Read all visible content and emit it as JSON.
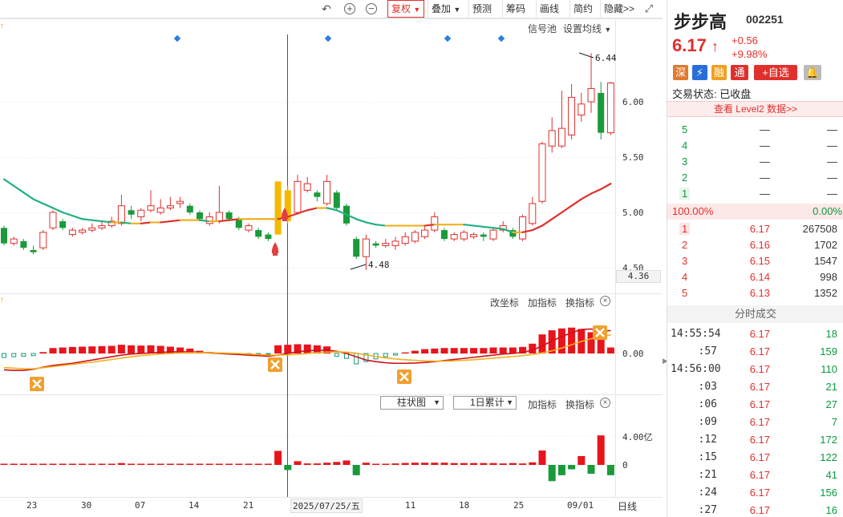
{
  "toolbar": {
    "fuquan": "复权",
    "diejia": "叠加",
    "yuce": "预测",
    "chouma": "筹码",
    "huaxian": "画线",
    "jianyue": "简约",
    "yincang": "隐藏>>"
  },
  "main_panel": {
    "signal_pool": "信号池",
    "ma_setting": "设置均线",
    "high_label": "6.44",
    "low_label": "4.48",
    "cursor_price": "4.36",
    "yticks": [
      "6.00",
      "5.50",
      "5.00",
      "4.50"
    ]
  },
  "macd_panel": {
    "gaizuobiao": "改坐标",
    "jiazhibiao": "加指标",
    "huanzhibiao": "换指标",
    "ytick": "0.00"
  },
  "vol_panel": {
    "chart_type": "柱状图",
    "accum": "1日累计",
    "jiazhibiao": "加指标",
    "huanzhibiao": "换指标",
    "yticks": [
      "4.00亿",
      "0"
    ]
  },
  "xaxis": {
    "ticks": [
      "23",
      "30",
      "07",
      "14",
      "21",
      "11",
      "18",
      "25",
      "09/01"
    ],
    "cursor_date": "2025/07/25/五",
    "period": "日线"
  },
  "stock": {
    "name": "步步高",
    "code": "002251",
    "price": "6.17",
    "change": "+0.56",
    "change_pct": "+9.98%",
    "tags": [
      "深",
      "融",
      "通"
    ],
    "add_fav": "+自选",
    "status_label": "交易状态:",
    "status": "已收盘",
    "level2": "查看 Level2 数据>>"
  },
  "sell_orders": [
    {
      "level": "5",
      "price": "—",
      "vol": "—"
    },
    {
      "level": "4",
      "price": "—",
      "vol": "—"
    },
    {
      "level": "3",
      "price": "—",
      "vol": "—"
    },
    {
      "level": "2",
      "price": "—",
      "vol": "—"
    },
    {
      "level": "1",
      "price": "—",
      "vol": "—"
    }
  ],
  "ratio": {
    "left": "100.00%",
    "right": "0.00%"
  },
  "buy_orders": [
    {
      "level": "1",
      "price": "6.17",
      "vol": "267508"
    },
    {
      "level": "2",
      "price": "6.16",
      "vol": "1702"
    },
    {
      "level": "3",
      "price": "6.15",
      "vol": "1547"
    },
    {
      "level": "4",
      "price": "6.14",
      "vol": "998"
    },
    {
      "level": "5",
      "price": "6.13",
      "vol": "1352"
    }
  ],
  "trades_title": "分时成交",
  "trades": [
    {
      "time": "14:55:54",
      "price": "6.17",
      "vol": "18"
    },
    {
      "time": ":57",
      "price": "6.17",
      "vol": "159"
    },
    {
      "time": "14:56:00",
      "price": "6.17",
      "vol": "110"
    },
    {
      "time": ":03",
      "price": "6.17",
      "vol": "21"
    },
    {
      "time": ":06",
      "price": "6.17",
      "vol": "27"
    },
    {
      "time": ":09",
      "price": "6.17",
      "vol": "7"
    },
    {
      "time": ":12",
      "price": "6.17",
      "vol": "172"
    },
    {
      "time": ":15",
      "price": "6.17",
      "vol": "122"
    },
    {
      "time": ":21",
      "price": "6.17",
      "vol": "41"
    },
    {
      "time": ":24",
      "price": "6.17",
      "vol": "156"
    },
    {
      "time": ":27",
      "price": "6.17",
      "vol": "16"
    }
  ],
  "chart_data": {
    "type": "candlestick",
    "ylim": [
      4.44,
      6.5
    ],
    "candles": [
      [
        4.86,
        4.72,
        4.88,
        4.7
      ],
      [
        4.72,
        4.76,
        4.78,
        4.7
      ],
      [
        4.74,
        4.68,
        4.76,
        4.66
      ],
      [
        4.66,
        4.64,
        4.7,
        4.62
      ],
      [
        4.68,
        4.82,
        4.84,
        4.66
      ],
      [
        4.86,
        5.0,
        5.02,
        4.84
      ],
      [
        4.92,
        4.86,
        4.94,
        4.84
      ],
      [
        4.8,
        4.84,
        4.86,
        4.78
      ],
      [
        4.82,
        4.84,
        4.86,
        4.8
      ],
      [
        4.84,
        4.86,
        4.9,
        4.82
      ],
      [
        4.86,
        4.88,
        4.92,
        4.84
      ],
      [
        4.88,
        4.92,
        4.96,
        4.86
      ],
      [
        4.9,
        5.06,
        5.16,
        4.88
      ],
      [
        5.02,
        4.98,
        5.06,
        4.94
      ],
      [
        4.96,
        5.02,
        5.04,
        4.92
      ],
      [
        5.02,
        5.06,
        5.2,
        5.0
      ],
      [
        5.0,
        5.04,
        5.12,
        4.98
      ],
      [
        5.04,
        5.06,
        5.14,
        5.02
      ],
      [
        5.08,
        5.1,
        5.14,
        5.04
      ],
      [
        5.06,
        5.0,
        5.08,
        4.98
      ],
      [
        5.0,
        4.94,
        5.02,
        4.92
      ],
      [
        4.9,
        4.96,
        5.0,
        4.88
      ],
      [
        4.92,
        5.0,
        5.24,
        4.9
      ],
      [
        5.0,
        4.94,
        5.02,
        4.92
      ],
      [
        4.94,
        4.86,
        4.96,
        4.84
      ],
      [
        4.84,
        4.88,
        4.9,
        4.82
      ],
      [
        4.84,
        4.78,
        4.86,
        4.76
      ],
      [
        4.8,
        4.76,
        4.82,
        4.74
      ],
      [
        4.8,
        5.28,
        5.28,
        4.8
      ],
      [
        5.2,
        4.92,
        5.24,
        4.9
      ],
      [
        5.0,
        5.28,
        5.34,
        4.98
      ],
      [
        5.2,
        5.26,
        5.32,
        5.18
      ],
      [
        5.18,
        5.14,
        5.2,
        5.1
      ],
      [
        5.08,
        5.28,
        5.34,
        5.06
      ],
      [
        5.18,
        5.04,
        5.2,
        5.02
      ],
      [
        5.06,
        4.9,
        5.08,
        4.88
      ],
      [
        4.76,
        4.6,
        4.78,
        4.58
      ],
      [
        4.6,
        4.76,
        4.8,
        4.48
      ],
      [
        4.72,
        4.7,
        4.74,
        4.68
      ],
      [
        4.7,
        4.72,
        4.76,
        4.68
      ],
      [
        4.7,
        4.74,
        4.78,
        4.66
      ],
      [
        4.72,
        4.78,
        4.82,
        4.7
      ],
      [
        4.74,
        4.82,
        4.84,
        4.72
      ],
      [
        4.78,
        4.84,
        4.88,
        4.76
      ],
      [
        4.84,
        4.96,
        5.0,
        4.82
      ],
      [
        4.84,
        4.76,
        4.86,
        4.74
      ],
      [
        4.76,
        4.8,
        4.82,
        4.74
      ],
      [
        4.76,
        4.82,
        4.84,
        4.74
      ],
      [
        4.78,
        4.8,
        4.82,
        4.76
      ],
      [
        4.8,
        4.78,
        4.82,
        4.74
      ],
      [
        4.76,
        4.84,
        4.86,
        4.74
      ],
      [
        4.84,
        4.88,
        4.92,
        4.82
      ],
      [
        4.84,
        4.78,
        4.86,
        4.76
      ],
      [
        4.76,
        4.96,
        4.98,
        4.74
      ],
      [
        4.9,
        5.08,
        5.14,
        4.88
      ],
      [
        5.1,
        5.62,
        5.64,
        5.08
      ],
      [
        5.6,
        5.74,
        5.86,
        5.54
      ],
      [
        5.6,
        5.76,
        6.1,
        5.58
      ],
      [
        5.7,
        6.04,
        6.16,
        5.66
      ],
      [
        5.88,
        5.98,
        6.08,
        5.82
      ],
      [
        6.0,
        6.12,
        6.44,
        5.9
      ],
      [
        6.08,
        5.72,
        6.18,
        5.66
      ],
      [
        5.72,
        6.17,
        6.18,
        5.7
      ]
    ],
    "ma_values": [
      5.3,
      5.24,
      5.18,
      5.12,
      5.08,
      5.04,
      5.0,
      4.97,
      4.94,
      4.93,
      4.92,
      4.91,
      4.91,
      4.9,
      4.9,
      4.91,
      4.91,
      4.92,
      4.93,
      4.93,
      4.93,
      4.92,
      4.92,
      4.93,
      4.94,
      4.94,
      4.94,
      4.94,
      4.94,
      4.96,
      4.99,
      5.02,
      5.04,
      5.04,
      5.02,
      4.98,
      4.94,
      4.91,
      4.89,
      4.88,
      4.88,
      4.88,
      4.88,
      4.88,
      4.89,
      4.89,
      4.89,
      4.89,
      4.88,
      4.87,
      4.86,
      4.85,
      4.82,
      4.82,
      4.84,
      4.88,
      4.94,
      5.0,
      5.06,
      5.12,
      5.17,
      5.21,
      5.26
    ],
    "macd": [
      -0.15,
      -0.12,
      -0.1,
      -0.08,
      0.05,
      0.2,
      0.22,
      0.24,
      0.25,
      0.26,
      0.27,
      0.28,
      0.32,
      0.3,
      0.29,
      0.3,
      0.28,
      0.25,
      0.22,
      0.18,
      0.1,
      0.06,
      0.04,
      -0.02,
      -0.04,
      -0.05,
      -0.04,
      -0.03,
      0.3,
      0.32,
      0.34,
      0.33,
      0.3,
      0.26,
      -0.1,
      -0.18,
      -0.38,
      -0.3,
      -0.2,
      -0.12,
      -0.06,
      0.04,
      0.1,
      0.16,
      0.18,
      0.2,
      0.2,
      0.2,
      0.2,
      0.2,
      0.22,
      0.22,
      0.22,
      0.24,
      0.36,
      0.7,
      0.85,
      0.92,
      0.95,
      0.9,
      0.78,
      0.72,
      0.22
    ],
    "dif": [
      -0.6,
      -0.62,
      -0.62,
      -0.58,
      -0.5,
      -0.44,
      -0.4,
      -0.36,
      -0.3,
      -0.24,
      -0.18,
      -0.12,
      -0.06,
      -0.02,
      0.0,
      0.02,
      0.04,
      0.06,
      0.06,
      0.06,
      0.05,
      0.02,
      0.0,
      -0.02,
      -0.04,
      -0.06,
      -0.08,
      -0.1,
      -0.06,
      0.0,
      0.06,
      0.1,
      0.12,
      0.12,
      0.08,
      0.0,
      -0.12,
      -0.24,
      -0.3,
      -0.34,
      -0.36,
      -0.36,
      -0.35,
      -0.33,
      -0.3,
      -0.26,
      -0.22,
      -0.18,
      -0.14,
      -0.1,
      -0.06,
      -0.02,
      0.0,
      0.04,
      0.12,
      0.28,
      0.46,
      0.62,
      0.76,
      0.88,
      0.9,
      0.82,
      0.84
    ],
    "dea": [
      -0.52,
      -0.54,
      -0.56,
      -0.56,
      -0.52,
      -0.48,
      -0.44,
      -0.4,
      -0.36,
      -0.32,
      -0.27,
      -0.22,
      -0.17,
      -0.12,
      -0.08,
      -0.05,
      -0.02,
      0.0,
      0.02,
      0.03,
      0.03,
      0.03,
      0.02,
      0.01,
      0.0,
      -0.02,
      -0.04,
      -0.06,
      -0.06,
      -0.05,
      -0.03,
      0.0,
      0.03,
      0.05,
      0.06,
      0.05,
      0.01,
      -0.05,
      -0.11,
      -0.16,
      -0.2,
      -0.23,
      -0.25,
      -0.27,
      -0.28,
      -0.28,
      -0.27,
      -0.25,
      -0.23,
      -0.2,
      -0.17,
      -0.14,
      -0.11,
      -0.08,
      -0.04,
      0.02,
      0.1,
      0.2,
      0.32,
      0.44,
      0.54,
      0.62,
      0.68
    ],
    "volume": [
      0.03,
      0.03,
      0.03,
      0.03,
      0.08,
      0.12,
      0.06,
      0.04,
      0.03,
      0.03,
      0.04,
      0.05,
      0.25,
      0.08,
      0.06,
      0.08,
      0.06,
      0.06,
      0.07,
      0.1,
      0.14,
      0.1,
      0.1,
      0.1,
      0.12,
      0.1,
      0.1,
      0.12,
      1.9,
      -0.7,
      0.5,
      0.2,
      0.2,
      0.3,
      0.4,
      0.6,
      -1.4,
      0.3,
      0.12,
      0.14,
      0.2,
      0.26,
      0.3,
      0.3,
      0.3,
      0.3,
      0.25,
      0.25,
      0.25,
      0.25,
      0.25,
      0.2,
      0.25,
      0.2,
      0.35,
      1.95,
      -2.2,
      -1.4,
      -0.6,
      1.2,
      -1.2,
      4.0,
      -1.4
    ]
  }
}
